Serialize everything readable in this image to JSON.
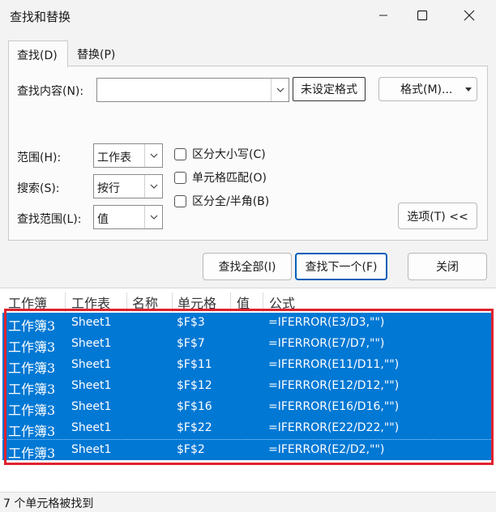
{
  "window": {
    "title": "查找和替换"
  },
  "tabs": [
    {
      "label": "查找(D)"
    },
    {
      "label": "替换(P)"
    }
  ],
  "find": {
    "content_label": "查找内容(N):",
    "content_value": "",
    "no_format_label": "未设定格式",
    "format_label": "格式(M)..."
  },
  "options": {
    "scope_label": "范围(H):",
    "scope_value": "工作表",
    "search_label": "搜索(S):",
    "search_value": "按行",
    "lookin_label": "查找范围(L):",
    "lookin_value": "值",
    "match_case": "区分大小写(C)",
    "match_cell": "单元格匹配(O)",
    "match_byte": "区分全/半角(B)",
    "options_button": "选项(T) <<"
  },
  "actions": {
    "find_all": "查找全部(I)",
    "find_next": "查找下一个(F)",
    "close": "关闭"
  },
  "results": {
    "columns": [
      "工作簿",
      "工作表",
      "名称",
      "单元格",
      "值",
      "公式"
    ],
    "rows": [
      {
        "book": "工作簿3",
        "sheet": "Sheet1",
        "name": "",
        "cell": "$F$3",
        "value": "",
        "formula": "=IFERROR(E3/D3,\"\")"
      },
      {
        "book": "工作簿3",
        "sheet": "Sheet1",
        "name": "",
        "cell": "$F$7",
        "value": "",
        "formula": "=IFERROR(E7/D7,\"\")"
      },
      {
        "book": "工作簿3",
        "sheet": "Sheet1",
        "name": "",
        "cell": "$F$11",
        "value": "",
        "formula": "=IFERROR(E11/D11,\"\")"
      },
      {
        "book": "工作簿3",
        "sheet": "Sheet1",
        "name": "",
        "cell": "$F$12",
        "value": "",
        "formula": "=IFERROR(E12/D12,\"\")"
      },
      {
        "book": "工作簿3",
        "sheet": "Sheet1",
        "name": "",
        "cell": "$F$16",
        "value": "",
        "formula": "=IFERROR(E16/D16,\"\")"
      },
      {
        "book": "工作簿3",
        "sheet": "Sheet1",
        "name": "",
        "cell": "$F$22",
        "value": "",
        "formula": "=IFERROR(E22/D22,\"\")"
      },
      {
        "book": "工作簿3",
        "sheet": "Sheet1",
        "name": "",
        "cell": "$F$2",
        "value": "",
        "formula": "=IFERROR(E2/D2,\"\")"
      }
    ]
  },
  "status": {
    "text": "7 个单元格被找到"
  },
  "colors": {
    "selection": "#0078d4",
    "highlight_border": "#e0222e",
    "accent": "#005fb8"
  }
}
